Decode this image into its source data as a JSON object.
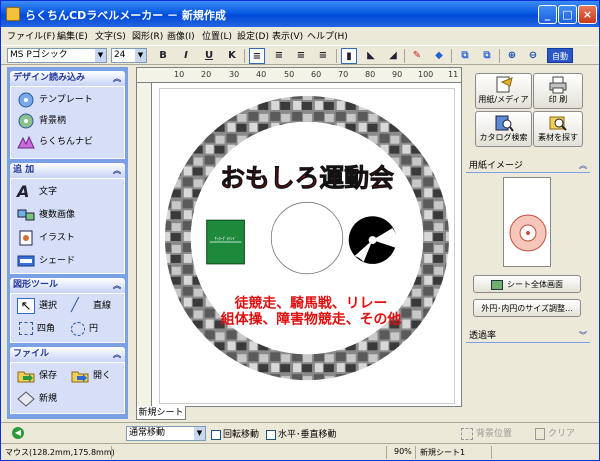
{
  "window": {
    "title": "らくちんCDラベルメーカー － 新規作成",
    "min": "_",
    "max": "□",
    "close": "×"
  },
  "menu": [
    "ファイル(F)",
    "編集(E)",
    "文字(S)",
    "図形(R)",
    "画像(I)",
    "位置(L)",
    "設定(D)",
    "表示(V)",
    "ヘルプ(H)"
  ],
  "toolbar": {
    "font": "MS Pゴシック",
    "size": "24",
    "bold": "B",
    "italic": "I",
    "underline": "U",
    "strike": "K",
    "auto": "自動"
  },
  "left": {
    "design": {
      "title": "デザイン読み込み",
      "items": [
        "テンプレート",
        "背景柄",
        "らくちんナビ"
      ]
    },
    "add": {
      "title": "追 加",
      "items": [
        "文字",
        "複数画像",
        "イラスト",
        "シェード"
      ]
    },
    "shapes": {
      "title": "図形ツール",
      "items": [
        "選択",
        "直線",
        "四角",
        "円"
      ]
    },
    "file": {
      "title": "ファイル",
      "items": [
        "保存",
        "開く",
        "新規"
      ]
    }
  },
  "ruler": [
    "10",
    "20",
    "30",
    "40",
    "50",
    "60",
    "70",
    "80",
    "90",
    "100",
    "11"
  ],
  "label": {
    "title": "おもしろ運動会",
    "line1": "徒競走、騎馬戦、リレー",
    "line2": "組体操、障害物競走、その他",
    "field_text": "ｻｯｶｰｸﾞﾗｳﾝﾄﾞ"
  },
  "sheet_tab": "新規シート1",
  "right": {
    "buttons": [
      "用紙/メディア",
      "印 刷",
      "カタログ検索",
      "素材を探す"
    ],
    "paper_title": "用紙イメージ",
    "sheet_view": "シート全体画面",
    "size_adjust": "外円･内円のサイズ調整...",
    "transparency": "透過率"
  },
  "bottom": {
    "move_mode": "通常移動",
    "rotate": "回転移動",
    "hv": "水平･垂直移動",
    "bg_pos": "背景位置",
    "clear": "クリア"
  },
  "status": {
    "mouse": "マウス(128.2mm,175.8mm)",
    "zoom": "90%",
    "sheet": "新規シート1"
  },
  "colors": {
    "accent": "#0a5be4",
    "panel": "#7aa1e6",
    "title_red": "#e01010"
  }
}
